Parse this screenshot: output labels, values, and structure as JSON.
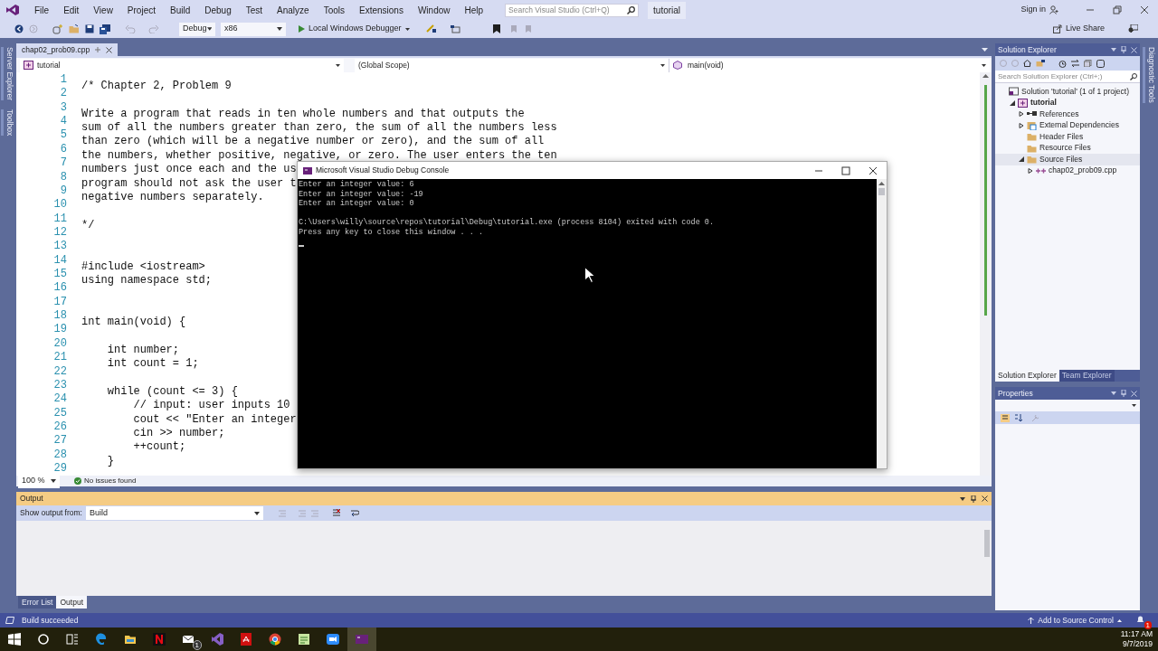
{
  "menu_bar": {
    "items": [
      "File",
      "Edit",
      "View",
      "Project",
      "Build",
      "Debug",
      "Test",
      "Analyze",
      "Tools",
      "Extensions",
      "Window",
      "Help"
    ],
    "search": {
      "placeholder": "Search Visual Studio (Ctrl+Q)"
    },
    "solution_name": "tutorial",
    "sign_in": "Sign in"
  },
  "toolbar": {
    "configuration": "Debug",
    "platform": "x86",
    "debugger": "Local Windows Debugger",
    "live_share": "Live Share"
  },
  "left_side_tabs": [
    "Server Explorer",
    "Toolbox"
  ],
  "right_side_tabs": [
    "Diagnostic Tools"
  ],
  "editor": {
    "tabs": [
      {
        "label": "chap02_prob09.cpp",
        "selected": true
      }
    ],
    "project": "tutorial",
    "scope": "(Global Scope)",
    "member": "main(void)",
    "lines": [
      {
        "number": "1",
        "text": "/* Chapter 2, Problem 9"
      },
      {
        "number": "2"
      },
      {
        "number": "3",
        "text": "Write a program that reads in ten whole numbers and that outputs the"
      },
      {
        "number": "4",
        "text": "sum of all the numbers greater than zero, the sum of all the numbers less"
      },
      {
        "number": "5",
        "text": "than zero (which will be a negative number or zero), and the sum of all"
      },
      {
        "number": "6",
        "text": "the numbers, whether positive, negative, or zero. The user enters the ten"
      },
      {
        "number": "7",
        "text": "numbers just once each and the us"
      },
      {
        "number": "8",
        "text": "program should not ask the user t"
      },
      {
        "number": "9",
        "text": "negative numbers separately."
      },
      {
        "number": "10"
      },
      {
        "number": "11",
        "text": "*/"
      },
      {
        "number": "12"
      },
      {
        "number": "13"
      },
      {
        "number": "14",
        "text": "#include <iostream>"
      },
      {
        "number": "15",
        "text": "using namespace std;"
      },
      {
        "number": "16"
      },
      {
        "number": "17"
      },
      {
        "number": "18",
        "text": "int main(void) {"
      },
      {
        "number": "19"
      },
      {
        "number": "20",
        "text": "    int number;"
      },
      {
        "number": "21",
        "text": "    int count = 1;"
      },
      {
        "number": "22"
      },
      {
        "number": "23",
        "text": "    while (count <= 3) {"
      },
      {
        "number": "24",
        "text": "        // input: user inputs 10"
      },
      {
        "number": "25",
        "text": "        cout << \"Enter an integer"
      },
      {
        "number": "26",
        "text": "        cin >> number;"
      },
      {
        "number": "27",
        "text": "        ++count;"
      },
      {
        "number": "28",
        "text": "    }"
      },
      {
        "number": "29"
      }
    ],
    "zoom": "100 %",
    "issues": "No issues found"
  },
  "console": {
    "title": "Microsoft Visual Studio Debug Console",
    "output_lines": [
      "Enter an integer value: 6",
      "Enter an integer value: -19",
      "Enter an integer value: 0"
    ],
    "exit_lines": [
      "C:\\Users\\willy\\source\\repos\\tutorial\\Debug\\tutorial.exe (process 8104) exited with code 0.",
      "Press any key to close this window . . ."
    ]
  },
  "output_panel": {
    "title": "Output",
    "source_label": "Show output from:",
    "source": "Build",
    "tabs": [
      {
        "label": "Error List",
        "selected": false
      },
      {
        "label": "Output",
        "selected": true
      }
    ]
  },
  "solution_explorer": {
    "title": "Solution Explorer",
    "search": {
      "placeholder": "Search Solution Explorer (Ctrl+;)"
    },
    "tree": [
      {
        "label": "Solution 'tutorial' (1 of 1 project)",
        "kind": "solution",
        "selected": false,
        "children": [
          {
            "label": "tutorial",
            "kind": "project",
            "expanded": true,
            "selected": false,
            "children": [
              {
                "label": "References",
                "kind": "references",
                "expanded": false,
                "selected": false
              },
              {
                "label": "External Dependencies",
                "kind": "dependencies",
                "expanded": false,
                "selected": false
              },
              {
                "label": "Header Files",
                "kind": "folder",
                "selected": false
              },
              {
                "label": "Resource Files",
                "kind": "folder",
                "selected": false
              },
              {
                "label": "Source Files",
                "kind": "folder",
                "expanded": true,
                "selected": true,
                "children": [
                  {
                    "label": "chap02_prob09.cpp",
                    "kind": "cpp",
                    "expanded": false,
                    "selected": false
                  }
                ]
              }
            ]
          }
        ]
      }
    ],
    "tabs": [
      {
        "label": "Solution Explorer",
        "selected": true
      },
      {
        "label": "Team Explorer",
        "selected": false
      }
    ]
  },
  "properties": {
    "title": "Properties"
  },
  "status_bar": {
    "message": "Build succeeded",
    "source_control": "Add to Source Control",
    "notifications_badge": "1"
  },
  "taskbar": {
    "mail_badge": "1",
    "time": "11:17 AM",
    "date": "9/7/2019"
  }
}
